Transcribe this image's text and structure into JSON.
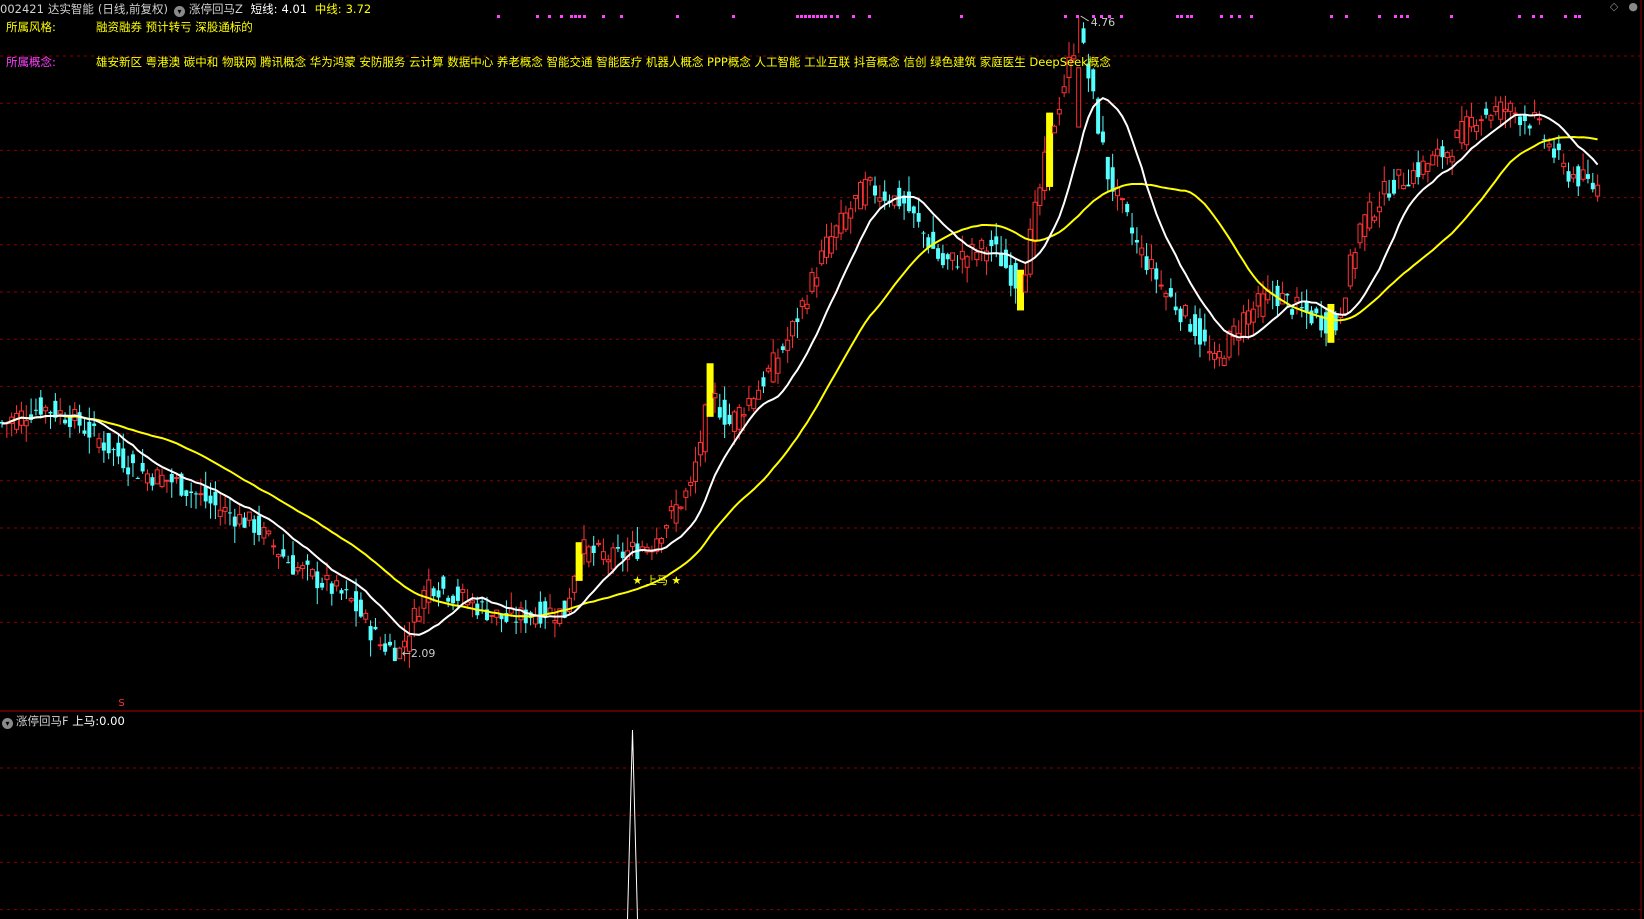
{
  "header": {
    "stock_code": "002421",
    "stock_name": "达实智能",
    "period_mode": "(日线,前复权)",
    "indicator_name": "涨停回马Z",
    "short_label": "短线:",
    "short_value": "4.01",
    "mid_label": "中线:",
    "mid_value": "3.72"
  },
  "style_row": {
    "label": "所属风格:",
    "tags": "融资融券 预计转亏 深股通标的"
  },
  "concept_row": {
    "label": "所属概念:",
    "tags": "雄安新区 粤港澳 碳中和 物联网 腾讯概念 华为鸿蒙 安防服务 云计算 数据中心 养老概念 智能交通 智能医疗 机器人概念 PPP概念 人工智能 工业互联 抖音概念 信创 绿色建筑 家庭医生 DeepSeek概念"
  },
  "annotations": {
    "high_label": "4.76",
    "low_label": "2.09",
    "star_text": "★ 上马 ★",
    "marker_s": "S"
  },
  "sub_panel": {
    "indicator_name": "涨停回马F",
    "shangma_label": "上马:",
    "shangma_value": "0.00"
  },
  "window_buttons": [
    "◇",
    "●"
  ],
  "colors": {
    "up": "#ff3333",
    "down": "#54ffff",
    "limit_up": "#ffff00",
    "short_line": "#ffffff",
    "mid_line": "#ffff00",
    "grid": "#8b0000",
    "concept_label": "#ff40ff",
    "signal_dot": "#ff40ff"
  },
  "chart_data": {
    "type": "candlestick",
    "x_count": 214,
    "price_high": 4.76,
    "price_low": 2.09,
    "short_ma_last": 4.01,
    "mid_ma_last": 3.72,
    "sub_indicator_peak": 1
  }
}
